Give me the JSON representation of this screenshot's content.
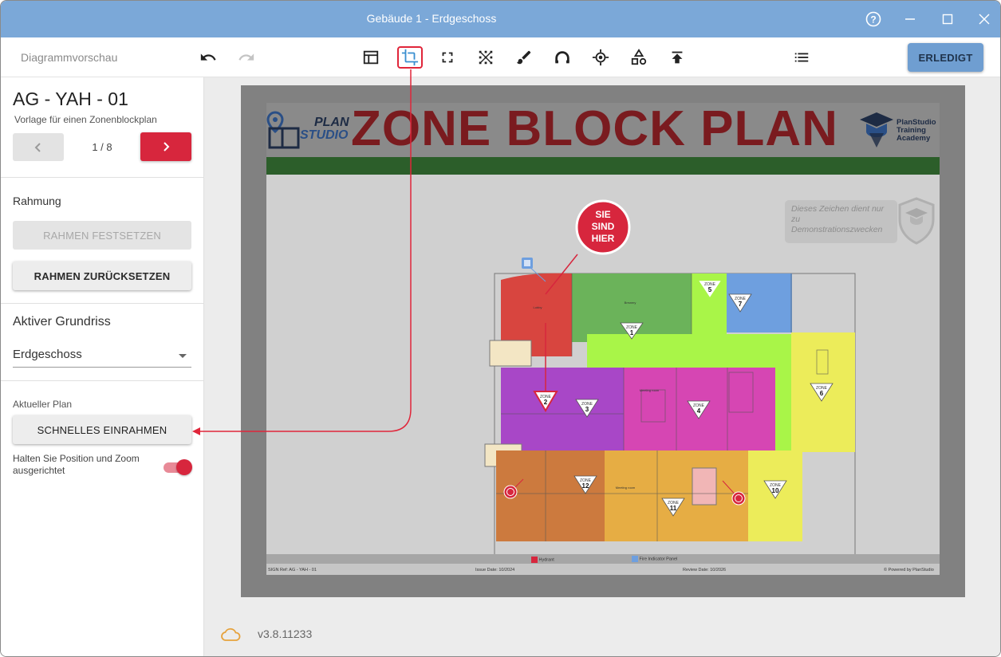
{
  "window": {
    "title": "Gebäude 1 - Erdgeschoss"
  },
  "toolbar": {
    "preview_label": "Diagrammvorschau",
    "done_label": "ERLEDIGT",
    "tools": [
      "undo-icon",
      "redo-icon",
      "layout-icon",
      "crop-icon",
      "fullscreen-icon",
      "grid-icon",
      "brush-icon",
      "arc-icon",
      "target-icon",
      "shapes-icon",
      "upload-icon",
      "list-icon"
    ]
  },
  "sidebar": {
    "plan_name": "AG - YAH - 01",
    "plan_subtitle": "Vorlage für einen Zonenblockplan",
    "page_indicator": "1 / 8",
    "framing_title": "Rahmung",
    "set_frame_label": "RAHMEN FESTSETZEN",
    "reset_frame_label": "RAHMEN ZURÜCKSETZEN",
    "active_floor_title": "Aktiver Grundriss",
    "floor_value": "Erdgeschoss",
    "current_plan_title": "Aktueller Plan",
    "quick_frame_label": "SCHNELLES EINRAHMEN",
    "keep_aligned_label": "Halten Sie Position und Zoom ausgerichtet",
    "keep_aligned_on": true
  },
  "preview": {
    "title": "ZONE BLOCK PLAN",
    "logo_plan_line1": "PLAN",
    "logo_plan_line2": "STUDIO",
    "logo_academy": [
      "PlanStudio",
      "Training",
      "Academy"
    ],
    "you_are_here": [
      "SIE",
      "SIND",
      "HIER"
    ],
    "demo_note": "Dieses Zeichen dient nur zu Demonstrationszwecken",
    "zones": [
      "1",
      "2",
      "3",
      "4",
      "5",
      "6",
      "7",
      "10",
      "11",
      "12"
    ],
    "zone_label": "ZONE",
    "legend_hydrant": "Hydrant",
    "legend_fip": "Fire Indicator Panel",
    "footer_sign_ref": "SIGN Ref: AG - YAH - 01",
    "footer_issue": "Issue Date: 10/2024",
    "footer_review": "Review Date: 10/2026",
    "footer_powered": "© Powered by PlanStudio",
    "room_labels": [
      "Lobby",
      "Brewery",
      "Meeting room",
      "Meeting room"
    ]
  },
  "status": {
    "version": "v3.8.11233"
  },
  "colors": {
    "accent_red": "#d7263d",
    "title_bar": "#7ba8d8",
    "done_button": "#6f9ed1"
  }
}
